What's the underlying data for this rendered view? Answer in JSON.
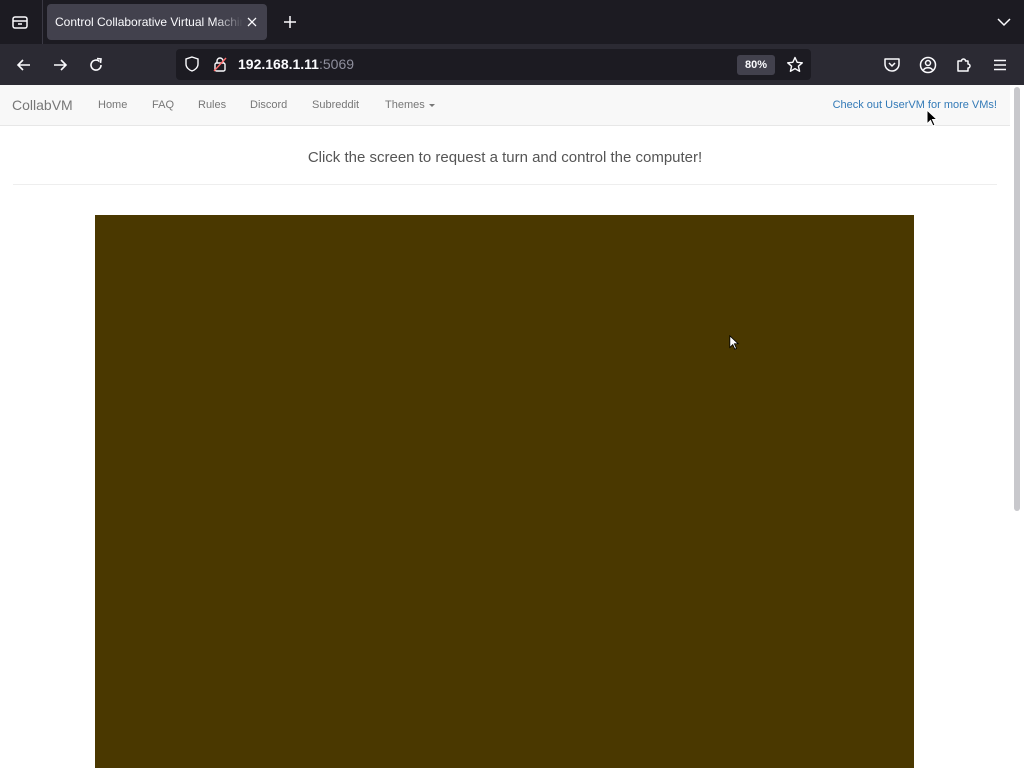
{
  "browser": {
    "tab": {
      "title": "Control Collaborative Virtual Machine"
    },
    "url": {
      "host": "192.168.1.11",
      "port": ":5069"
    },
    "zoom": "80%"
  },
  "site": {
    "brand": "CollabVM",
    "nav": {
      "home": "Home",
      "faq": "FAQ",
      "rules": "Rules",
      "discord": "Discord",
      "subreddit": "Subreddit",
      "themes": "Themes"
    },
    "promo": "Check out UserVM for more VMs!",
    "headline": "Click the screen to request a turn and control the computer!"
  },
  "colors": {
    "vm_screen": "#4a3800",
    "link": "#337ab7",
    "browser_chrome": "#2b2a33"
  }
}
